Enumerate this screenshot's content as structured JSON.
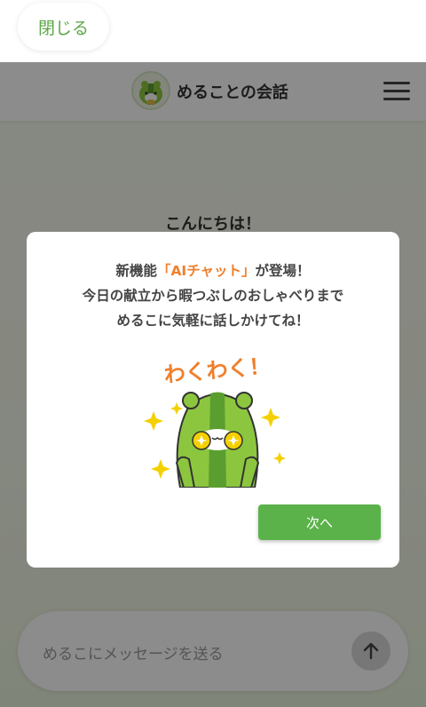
{
  "topbar": {
    "close_label": "閉じる"
  },
  "header": {
    "title": "めることの会話"
  },
  "chat": {
    "greeting": "こんにちは！"
  },
  "modal": {
    "line1_prefix": "新機能",
    "line1_highlight": "「AIチャット」",
    "line1_suffix": "が登場！",
    "line2": "今日の献立から暇つぶしのおしゃべりまで",
    "line3": "めるこに気軽に話しかけてね！",
    "illustration_text": "わくわく！",
    "next_label": "次へ"
  },
  "input": {
    "placeholder": "めるこにメッセージを送る"
  },
  "colors": {
    "accent_green": "#5bb24a",
    "accent_orange": "#f07f2c",
    "mascot_green": "#8cc63f"
  },
  "icons": {
    "menu": "hamburger-icon",
    "send": "arrow-up-icon",
    "avatar": "mascot-avatar-icon"
  }
}
